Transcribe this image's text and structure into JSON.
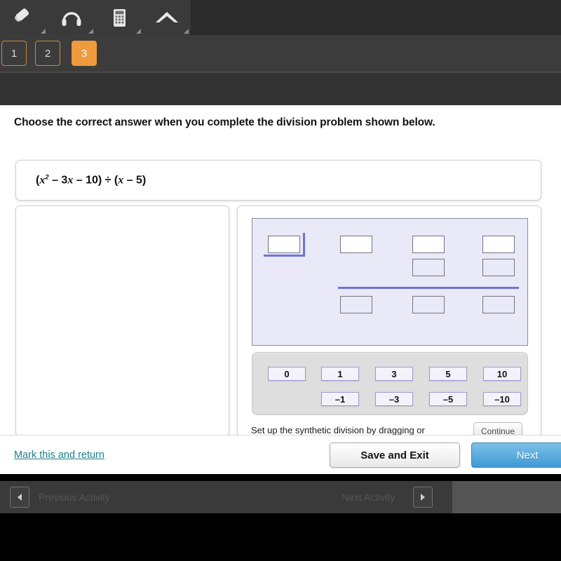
{
  "toolbar": {
    "tools": [
      {
        "name": "pencil-icon",
        "label": "Pencil"
      },
      {
        "name": "headphones-icon",
        "label": "Headphones"
      },
      {
        "name": "calculator-icon",
        "label": "Calculator"
      },
      {
        "name": "caret-up-icon",
        "label": "Collapse"
      }
    ]
  },
  "tabs": [
    {
      "label": "1",
      "active": false
    },
    {
      "label": "2",
      "active": false
    },
    {
      "label": "3",
      "active": true
    }
  ],
  "question": {
    "prompt": "Choose the correct answer when you complete the division problem shown below.",
    "expression": {
      "open_paren": "(",
      "term1_var": "x",
      "term1_exp": "2",
      "term2": " – 3",
      "term2_var": "x",
      "term3": " – 10) ÷ (",
      "term4_var": "x",
      "term5": " – 5)",
      "plain": "(x² – 3x – 10) ÷ (x – 5)"
    }
  },
  "workspace": {
    "instruction": "Set up the synthetic division by dragging or",
    "continue_label": "Continue",
    "drop_zones": {
      "divisor": "",
      "coefficients": [
        "",
        "",
        ""
      ],
      "carry_row": [
        "",
        ""
      ],
      "result_row": [
        "",
        "",
        ""
      ]
    }
  },
  "tiles": {
    "row_positive": [
      "0",
      "1",
      "3",
      "5",
      "10"
    ],
    "row_negative": [
      "–1",
      "–3",
      "–5",
      "–10"
    ]
  },
  "footer": {
    "mark_return": "Mark this and return",
    "save_exit": "Save and Exit",
    "next": "Next"
  },
  "activity_nav": {
    "previous": "Previous Activity",
    "next": "Next Activity"
  },
  "colors": {
    "tab_active": "#ef9a3d",
    "toolbar_dark": "#3a3a3a",
    "workspace_lavender": "#e9e9f8",
    "bracket_blue": "#6f73d8",
    "link_teal": "#1c7d8e",
    "next_blue": "#3f9ad6"
  }
}
